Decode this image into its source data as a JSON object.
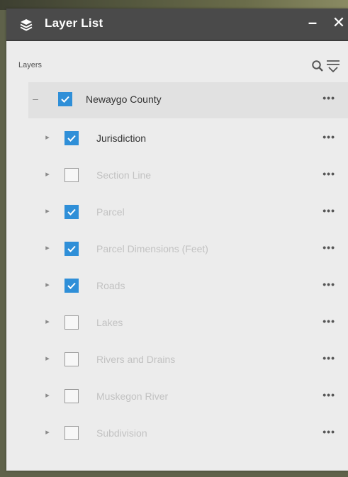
{
  "panel": {
    "title": "Layer List",
    "minimize_label": "–",
    "close_label": "✕"
  },
  "layers_header": {
    "label": "Layers",
    "search_icon": "search-icon",
    "filter_icon": "filter-icon"
  },
  "colors": {
    "titlebar": "#4a4a4a",
    "checkbox_checked": "#2f8fd8",
    "panel_bg": "#ececec"
  },
  "group": {
    "label": "Newaygo County",
    "expanded": true,
    "checked": true,
    "more_label": "•••"
  },
  "layers": [
    {
      "label": "Jurisdiction",
      "checked": true,
      "dim": false,
      "more_label": "•••"
    },
    {
      "label": "Section Line",
      "checked": false,
      "dim": true,
      "more_label": "•••"
    },
    {
      "label": "Parcel",
      "checked": true,
      "dim": true,
      "more_label": "•••"
    },
    {
      "label": "Parcel Dimensions (Feet)",
      "checked": true,
      "dim": true,
      "more_label": "•••"
    },
    {
      "label": "Roads",
      "checked": true,
      "dim": true,
      "more_label": "•••"
    },
    {
      "label": "Lakes",
      "checked": false,
      "dim": true,
      "more_label": "•••"
    },
    {
      "label": "Rivers and Drains",
      "checked": false,
      "dim": true,
      "more_label": "•••"
    },
    {
      "label": "Muskegon River",
      "checked": false,
      "dim": true,
      "more_label": "•••"
    },
    {
      "label": "Subdivision",
      "checked": false,
      "dim": true,
      "more_label": "•••"
    }
  ]
}
